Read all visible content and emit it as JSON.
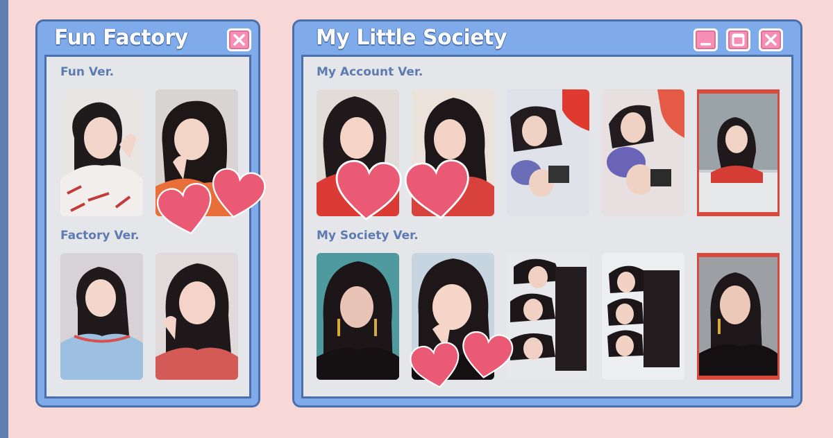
{
  "windows": {
    "fun_factory": {
      "title": "Fun Factory",
      "sections": [
        {
          "label": "Fun Ver.",
          "cards": [
            "photocard",
            "photocard"
          ]
        },
        {
          "label": "Factory Ver.",
          "cards": [
            "photocard",
            "photocard"
          ]
        }
      ]
    },
    "my_little_society": {
      "title": "My Little Society",
      "sections": [
        {
          "label": "My Account Ver.",
          "cards": [
            "photocard",
            "photocard",
            "photocard",
            "photocard",
            "photocard"
          ]
        },
        {
          "label": "My Society Ver.",
          "cards": [
            "photocard",
            "photocard",
            "photocard",
            "photocard",
            "photocard"
          ]
        }
      ]
    }
  },
  "icons": {
    "close": "close-icon",
    "minimize": "minimize-icon",
    "maximize": "maximize-icon",
    "heart": "heart-icon"
  },
  "colors": {
    "background": "#f8d8d6",
    "window_frame": "#7fabeb",
    "window_border": "#4c6fa9",
    "content_bg": "#e5e6ea",
    "label": "#5d7bb0",
    "button_pink": "#f590b4",
    "heart": "#ea5a74"
  }
}
